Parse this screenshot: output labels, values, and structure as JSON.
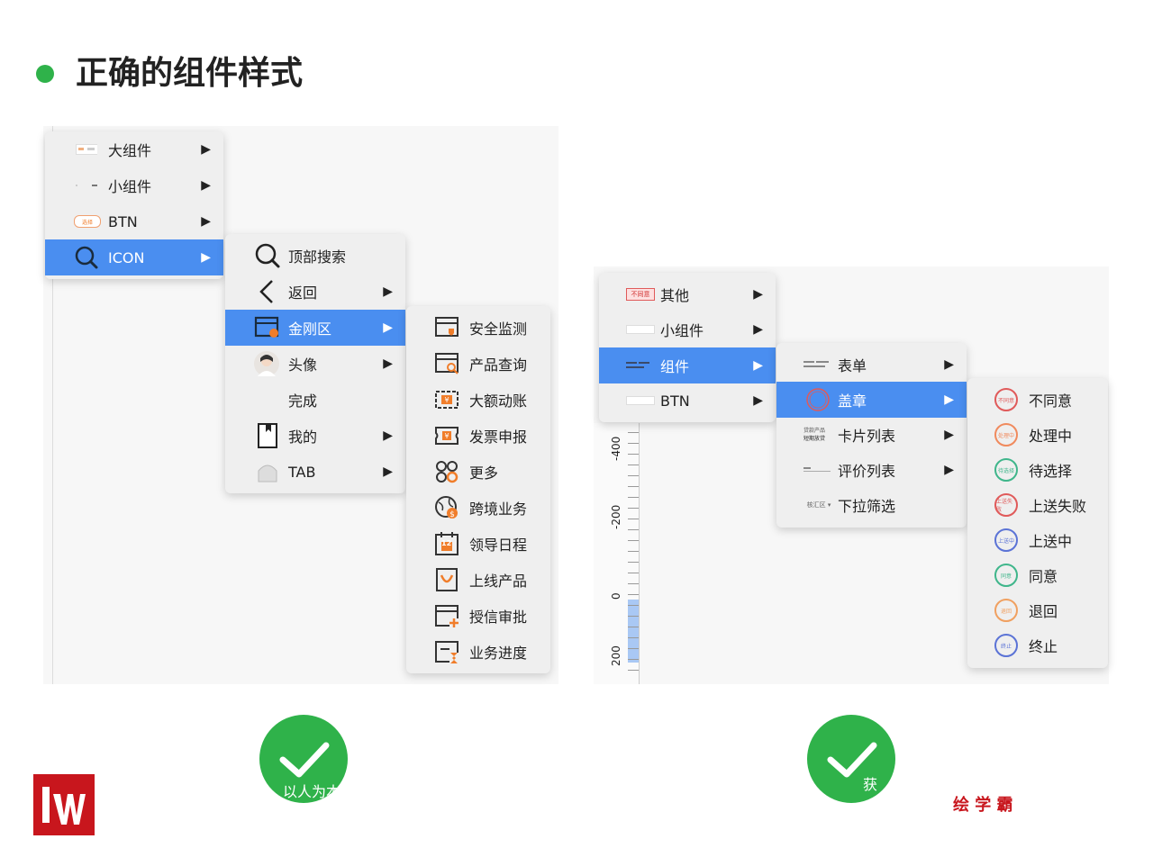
{
  "title": "正确的组件样式",
  "left_menu": {
    "level1": [
      {
        "label": "大组件",
        "thumb": "large-component-thumb",
        "selected": false
      },
      {
        "label": "小组件",
        "thumb": "small-component-thumb",
        "selected": false
      },
      {
        "label": "BTN",
        "thumb": "button-thumb",
        "thumb_text": "选择",
        "selected": false
      },
      {
        "label": "ICON",
        "thumb": "search-icon",
        "selected": true
      }
    ],
    "level2": [
      {
        "label": "顶部搜索",
        "icon": "search-icon",
        "has_sub": false
      },
      {
        "label": "返回",
        "icon": "back-chevron-icon",
        "has_sub": true
      },
      {
        "label": "金刚区",
        "icon": "card-icon",
        "has_sub": true,
        "selected": true
      },
      {
        "label": "头像",
        "icon": "avatar-icon",
        "has_sub": true
      },
      {
        "label": "完成",
        "icon": "",
        "has_sub": false
      },
      {
        "label": "我的",
        "icon": "bookmark-icon",
        "has_sub": true
      },
      {
        "label": "TAB",
        "icon": "tab-icon",
        "has_sub": true
      }
    ],
    "level3": [
      {
        "label": "安全监测",
        "icon": "security-monitor-icon"
      },
      {
        "label": "产品查询",
        "icon": "product-search-icon"
      },
      {
        "label": "大额动账",
        "icon": "large-transfer-icon"
      },
      {
        "label": "发票申报",
        "icon": "invoice-icon"
      },
      {
        "label": "更多",
        "icon": "more-icon"
      },
      {
        "label": "跨境业务",
        "icon": "cross-border-icon"
      },
      {
        "label": "领导日程",
        "icon": "calendar-icon",
        "badge": "12"
      },
      {
        "label": "上线产品",
        "icon": "online-product-icon"
      },
      {
        "label": "授信审批",
        "icon": "credit-approval-icon"
      },
      {
        "label": "业务进度",
        "icon": "business-progress-icon"
      }
    ]
  },
  "right_menu": {
    "level1": [
      {
        "label": "其他",
        "thumb": "disagree-tag-thumb",
        "thumb_text": "不同意"
      },
      {
        "label": "小组件",
        "thumb": "small-component-thumb"
      },
      {
        "label": "组件",
        "thumb": "component-thumb",
        "selected": true
      },
      {
        "label": "BTN",
        "thumb": "button-thumb"
      }
    ],
    "level2": [
      {
        "label": "表单",
        "thumb": "form-thumb"
      },
      {
        "label": "盖章",
        "thumb": "stamp-thumb",
        "selected": true
      },
      {
        "label": "卡片列表",
        "thumb": "card-list-thumb",
        "thumb_text_1": "贷款产品",
        "thumb_text_2": "短期放贷"
      },
      {
        "label": "评价列表",
        "thumb": "review-list-thumb"
      },
      {
        "label": "下拉筛选",
        "thumb": "dropdown-thumb",
        "thumb_text": "核汇区 ▾"
      }
    ],
    "level3": [
      {
        "label": "不同意",
        "color": "#e05a5a",
        "stamp": "不同意"
      },
      {
        "label": "处理中",
        "color": "#f08a5d",
        "stamp": "处理中"
      },
      {
        "label": "待选择",
        "color": "#3fb68b",
        "stamp": "待选择"
      },
      {
        "label": "上送失败",
        "color": "#e05a5a",
        "stamp": "上送失败"
      },
      {
        "label": "上送中",
        "color": "#5b73d6",
        "stamp": "上送中"
      },
      {
        "label": "同意",
        "color": "#3fb68b",
        "stamp": "同意"
      },
      {
        "label": "退回",
        "color": "#f0a060",
        "stamp": "退回"
      },
      {
        "label": "终止",
        "color": "#5b73d6",
        "stamp": "终止"
      }
    ]
  },
  "ruler": {
    "labels": [
      "-400",
      "-200",
      "0",
      "200"
    ]
  },
  "captions": {
    "left": "以人为本",
    "right": "获"
  },
  "brand": {
    "text": "绘 学 霸",
    "color": "#c8161d"
  },
  "colors": {
    "accent_green": "#2fb24a",
    "selection_blue": "#4a8ef0",
    "orange_icon": "#f07d2a"
  }
}
